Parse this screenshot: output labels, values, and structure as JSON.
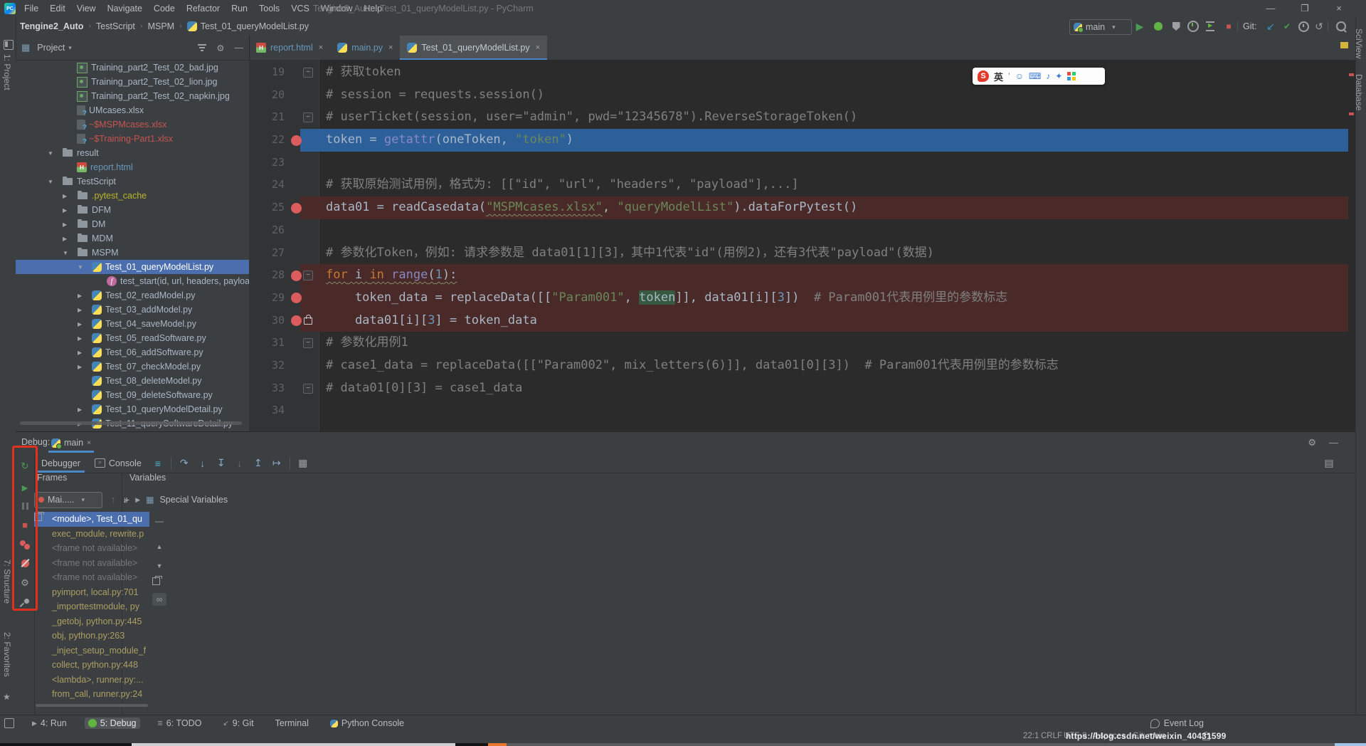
{
  "window": {
    "logo": "PC",
    "title": "Tengine2_Auto - Test_01_queryModelList.py - PyCharm",
    "menus": [
      "File",
      "Edit",
      "View",
      "Navigate",
      "Code",
      "Refactor",
      "Run",
      "Tools",
      "VCS",
      "Window",
      "Help"
    ]
  },
  "breadcrumbs": [
    "Tengine2_Auto",
    "TestScript",
    "MSPM",
    "Test_01_queryModelList.py"
  ],
  "toolbar": {
    "run_config": "main",
    "git_label": "Git:"
  },
  "left_stripe": {
    "project": "1: Project",
    "structure": "7: Structure",
    "favorites": "2: Favorites"
  },
  "right_stripe": {
    "top": "SciView",
    "bottom": "Database"
  },
  "project_panel": {
    "title": "Project",
    "tree": [
      {
        "level": 2,
        "icon": "img",
        "label": "Training_part2_Test_02_bad.jpg"
      },
      {
        "level": 2,
        "icon": "img",
        "label": "Training_part2_Test_02_lion.jpg"
      },
      {
        "level": 2,
        "icon": "img",
        "label": "Training_part2_Test_02_napkin.jpg"
      },
      {
        "level": 2,
        "icon": "xls",
        "label": "UMcases.xlsx"
      },
      {
        "level": 2,
        "icon": "xls",
        "label": "~$MSPMcases.xlsx",
        "cls": "red"
      },
      {
        "level": 2,
        "icon": "xls",
        "label": "~$Training-Part1.xlsx",
        "cls": "red"
      },
      {
        "level": 1,
        "arrow": "down",
        "icon": "folder",
        "label": "result"
      },
      {
        "level": 2,
        "icon": "html",
        "label": "report.html",
        "cls": "blue"
      },
      {
        "level": 1,
        "arrow": "down",
        "icon": "folder",
        "label": "TestScript"
      },
      {
        "level": 2,
        "arrow": "right",
        "icon": "folder",
        "label": ".pytest_cache",
        "cls": "olive"
      },
      {
        "level": 2,
        "arrow": "right",
        "icon": "folder",
        "label": "DFM"
      },
      {
        "level": 2,
        "arrow": "right",
        "icon": "folder",
        "label": "DM"
      },
      {
        "level": 2,
        "arrow": "right",
        "icon": "folder",
        "label": "MDM"
      },
      {
        "level": 2,
        "arrow": "down",
        "icon": "folder",
        "label": "MSPM"
      },
      {
        "level": 3,
        "arrow": "down",
        "icon": "py",
        "label": "Test_01_queryModelList.py",
        "selected": true
      },
      {
        "level": 4,
        "icon": "func",
        "label": "test_start(id, url, headers, payload)"
      },
      {
        "level": 3,
        "arrow": "right",
        "icon": "py",
        "label": "Test_02_readModel.py"
      },
      {
        "level": 3,
        "arrow": "right",
        "icon": "py",
        "label": "Test_03_addModel.py"
      },
      {
        "level": 3,
        "arrow": "right",
        "icon": "py",
        "label": "Test_04_saveModel.py"
      },
      {
        "level": 3,
        "arrow": "right",
        "icon": "py",
        "label": "Test_05_readSoftware.py"
      },
      {
        "level": 3,
        "arrow": "right",
        "icon": "py",
        "label": "Test_06_addSoftware.py"
      },
      {
        "level": 3,
        "arrow": "right",
        "icon": "py",
        "label": "Test_07_checkModel.py"
      },
      {
        "level": 3,
        "icon": "py",
        "label": "Test_08_deleteModel.py"
      },
      {
        "level": 3,
        "icon": "py",
        "label": "Test_09_deleteSoftware.py"
      },
      {
        "level": 3,
        "arrow": "right",
        "icon": "py",
        "label": "Test_10_queryModelDetail.py"
      },
      {
        "level": 3,
        "arrow": "right",
        "icon": "py",
        "label": "Test_11_querySoftwareDetail.py"
      }
    ]
  },
  "editor": {
    "tabs": [
      {
        "label": "report.html",
        "icon": "html"
      },
      {
        "label": "main.py",
        "icon": "py"
      },
      {
        "label": "Test_01_queryModelList.py",
        "icon": "py",
        "active": true
      }
    ],
    "lines": [
      {
        "n": 19,
        "fold": "minus",
        "t": [
          {
            "c": "c",
            "t": "# 获取token"
          }
        ]
      },
      {
        "n": 20,
        "t": [
          {
            "c": "c",
            "t": "# session = requests.session()"
          }
        ]
      },
      {
        "n": 21,
        "fold": "minus",
        "t": [
          {
            "c": "c",
            "t": "# userTicket(session, user=\"admin\", pwd=\"12345678\").ReverseStorageToken()"
          }
        ]
      },
      {
        "n": 22,
        "bp": true,
        "bg": "exec",
        "t": [
          {
            "c": "w",
            "t": "token = "
          },
          {
            "c": "b",
            "t": "getattr"
          },
          {
            "c": "w",
            "t": "(oneToken, "
          },
          {
            "c": "s",
            "t": "\"token\""
          },
          {
            "c": "w",
            "t": ")"
          }
        ]
      },
      {
        "n": 23,
        "t": []
      },
      {
        "n": 24,
        "t": [
          {
            "c": "c",
            "t": "# 获取原始测试用例，格式为: [[\"id\", \"url\", \"headers\", \"payload\"],...]"
          }
        ]
      },
      {
        "n": 25,
        "bp": true,
        "bg": "bp",
        "t": [
          {
            "c": "w",
            "t": "data01 = readCasedata("
          },
          {
            "c": "s",
            "t": "\"MSPMcases.xlsx\"",
            "w": 1
          },
          {
            "c": "w",
            "t": ", "
          },
          {
            "c": "s",
            "t": "\"queryModelList\""
          },
          {
            "c": "w",
            "t": ").dataForPytest()"
          }
        ]
      },
      {
        "n": 26,
        "t": []
      },
      {
        "n": 27,
        "t": [
          {
            "c": "c",
            "t": "# 参数化Token，例如: 请求参数是 data01[1][3]，其中1代表\"id\"(用例2)，还有3代表\"payload\"(数据)"
          }
        ]
      },
      {
        "n": 28,
        "bp": true,
        "bg": "bp",
        "fold": "minus",
        "t": [
          {
            "c": "k",
            "t": "for",
            "w": 1
          },
          {
            "c": "w",
            "t": " i ",
            "w": 1
          },
          {
            "c": "k",
            "t": "in",
            "w": 1
          },
          {
            "c": "w",
            "t": " ",
            "w": 1
          },
          {
            "c": "b",
            "t": "range",
            "w": 1
          },
          {
            "c": "w",
            "t": "(",
            "w": 1
          },
          {
            "c": "n",
            "t": "1",
            "w": 1
          },
          {
            "c": "w",
            "t": "):",
            "w": 1
          }
        ]
      },
      {
        "n": 29,
        "bp": true,
        "bg": "bp",
        "t": [
          {
            "c": "w",
            "t": "    token_data = replaceData([["
          },
          {
            "c": "s",
            "t": "\"Param001\""
          },
          {
            "c": "w",
            "t": ", "
          },
          {
            "c": "w",
            "t": "token",
            "h": 1
          },
          {
            "c": "w",
            "t": "]], data01[i]["
          },
          {
            "c": "n",
            "t": "3"
          },
          {
            "c": "w",
            "t": "])  "
          },
          {
            "c": "c",
            "t": "# Param001代表用例里的参数标志"
          }
        ]
      },
      {
        "n": 30,
        "bp": true,
        "bg": "bp",
        "fold": "lock",
        "t": [
          {
            "c": "w",
            "t": "    data01[i]["
          },
          {
            "c": "n",
            "t": "3"
          },
          {
            "c": "w",
            "t": "] = token_data"
          }
        ]
      },
      {
        "n": 31,
        "fold": "minus",
        "t": [
          {
            "c": "c",
            "t": "# 参数化用例1"
          }
        ]
      },
      {
        "n": 32,
        "t": [
          {
            "c": "c",
            "t": "# case1_data = replaceData([[\"Param002\", mix_letters(6)]], data01[0][3])  # Param001代表用例里的参数标志"
          }
        ]
      },
      {
        "n": 33,
        "fold": "minus",
        "t": [
          {
            "c": "c",
            "t": "# data01[0][3] = case1_data"
          }
        ]
      },
      {
        "n": 34,
        "t": []
      }
    ]
  },
  "ime": {
    "logo": "S",
    "mode": "英"
  },
  "debug": {
    "label": "Debug:",
    "session_tab": "main",
    "tab_debugger": "Debugger",
    "tab_console": "Console",
    "frames_header": "Frames",
    "variables_header": "Variables",
    "thread": "Mai.....",
    "special_variables": "Special Variables",
    "frames": [
      {
        "label": "<module>, Test_01_qu",
        "selected": true
      },
      {
        "label": "exec_module, rewrite.p",
        "cls": "lib"
      },
      {
        "label": "<frame not available>",
        "cls": "dim"
      },
      {
        "label": "<frame not available>",
        "cls": "dim"
      },
      {
        "label": "<frame not available>",
        "cls": "dim"
      },
      {
        "label": "pyimport, local.py:701",
        "cls": "lib"
      },
      {
        "label": "_importtestmodule, py",
        "cls": "lib"
      },
      {
        "label": "_getobj, python.py:445",
        "cls": "lib"
      },
      {
        "label": "obj, python.py:263",
        "cls": "lib"
      },
      {
        "label": "_inject_setup_module_f",
        "cls": "lib"
      },
      {
        "label": "collect, python.py:448",
        "cls": "lib"
      },
      {
        "label": "<lambda>, runner.py:...",
        "cls": "lib"
      },
      {
        "label": "from_call, runner.py:24",
        "cls": "lib"
      }
    ]
  },
  "statusbar": {
    "tool_buttons": [
      {
        "label": "4: Run",
        "icon": "run"
      },
      {
        "label": "5: Debug",
        "icon": "debug",
        "active": true
      },
      {
        "label": "6: TODO",
        "icon": "todo"
      },
      {
        "label": "9: Git",
        "icon": "git"
      },
      {
        "label": "Terminal",
        "icon": "none"
      },
      {
        "label": "Python Console",
        "icon": "py"
      }
    ],
    "event_log": "Event Log",
    "caret": "22:1",
    "line_ending": "CRLF",
    "encoding": "UTF-8",
    "indent": "4 spaces",
    "git_branch": "Git: main",
    "watermark": "https://blog.csdn.net/weixin_40431599"
  },
  "colors": {
    "accent_blue": "#4A88C7",
    "selection_blue": "#4B6EAF",
    "exec_line": "#2D6099",
    "breakpoint_line": "#4A2A28",
    "breakpoint_red": "#DB5C5C",
    "annotation_red": "#E0301E",
    "string_green": "#6A8759",
    "keyword_orange": "#CC7832"
  }
}
